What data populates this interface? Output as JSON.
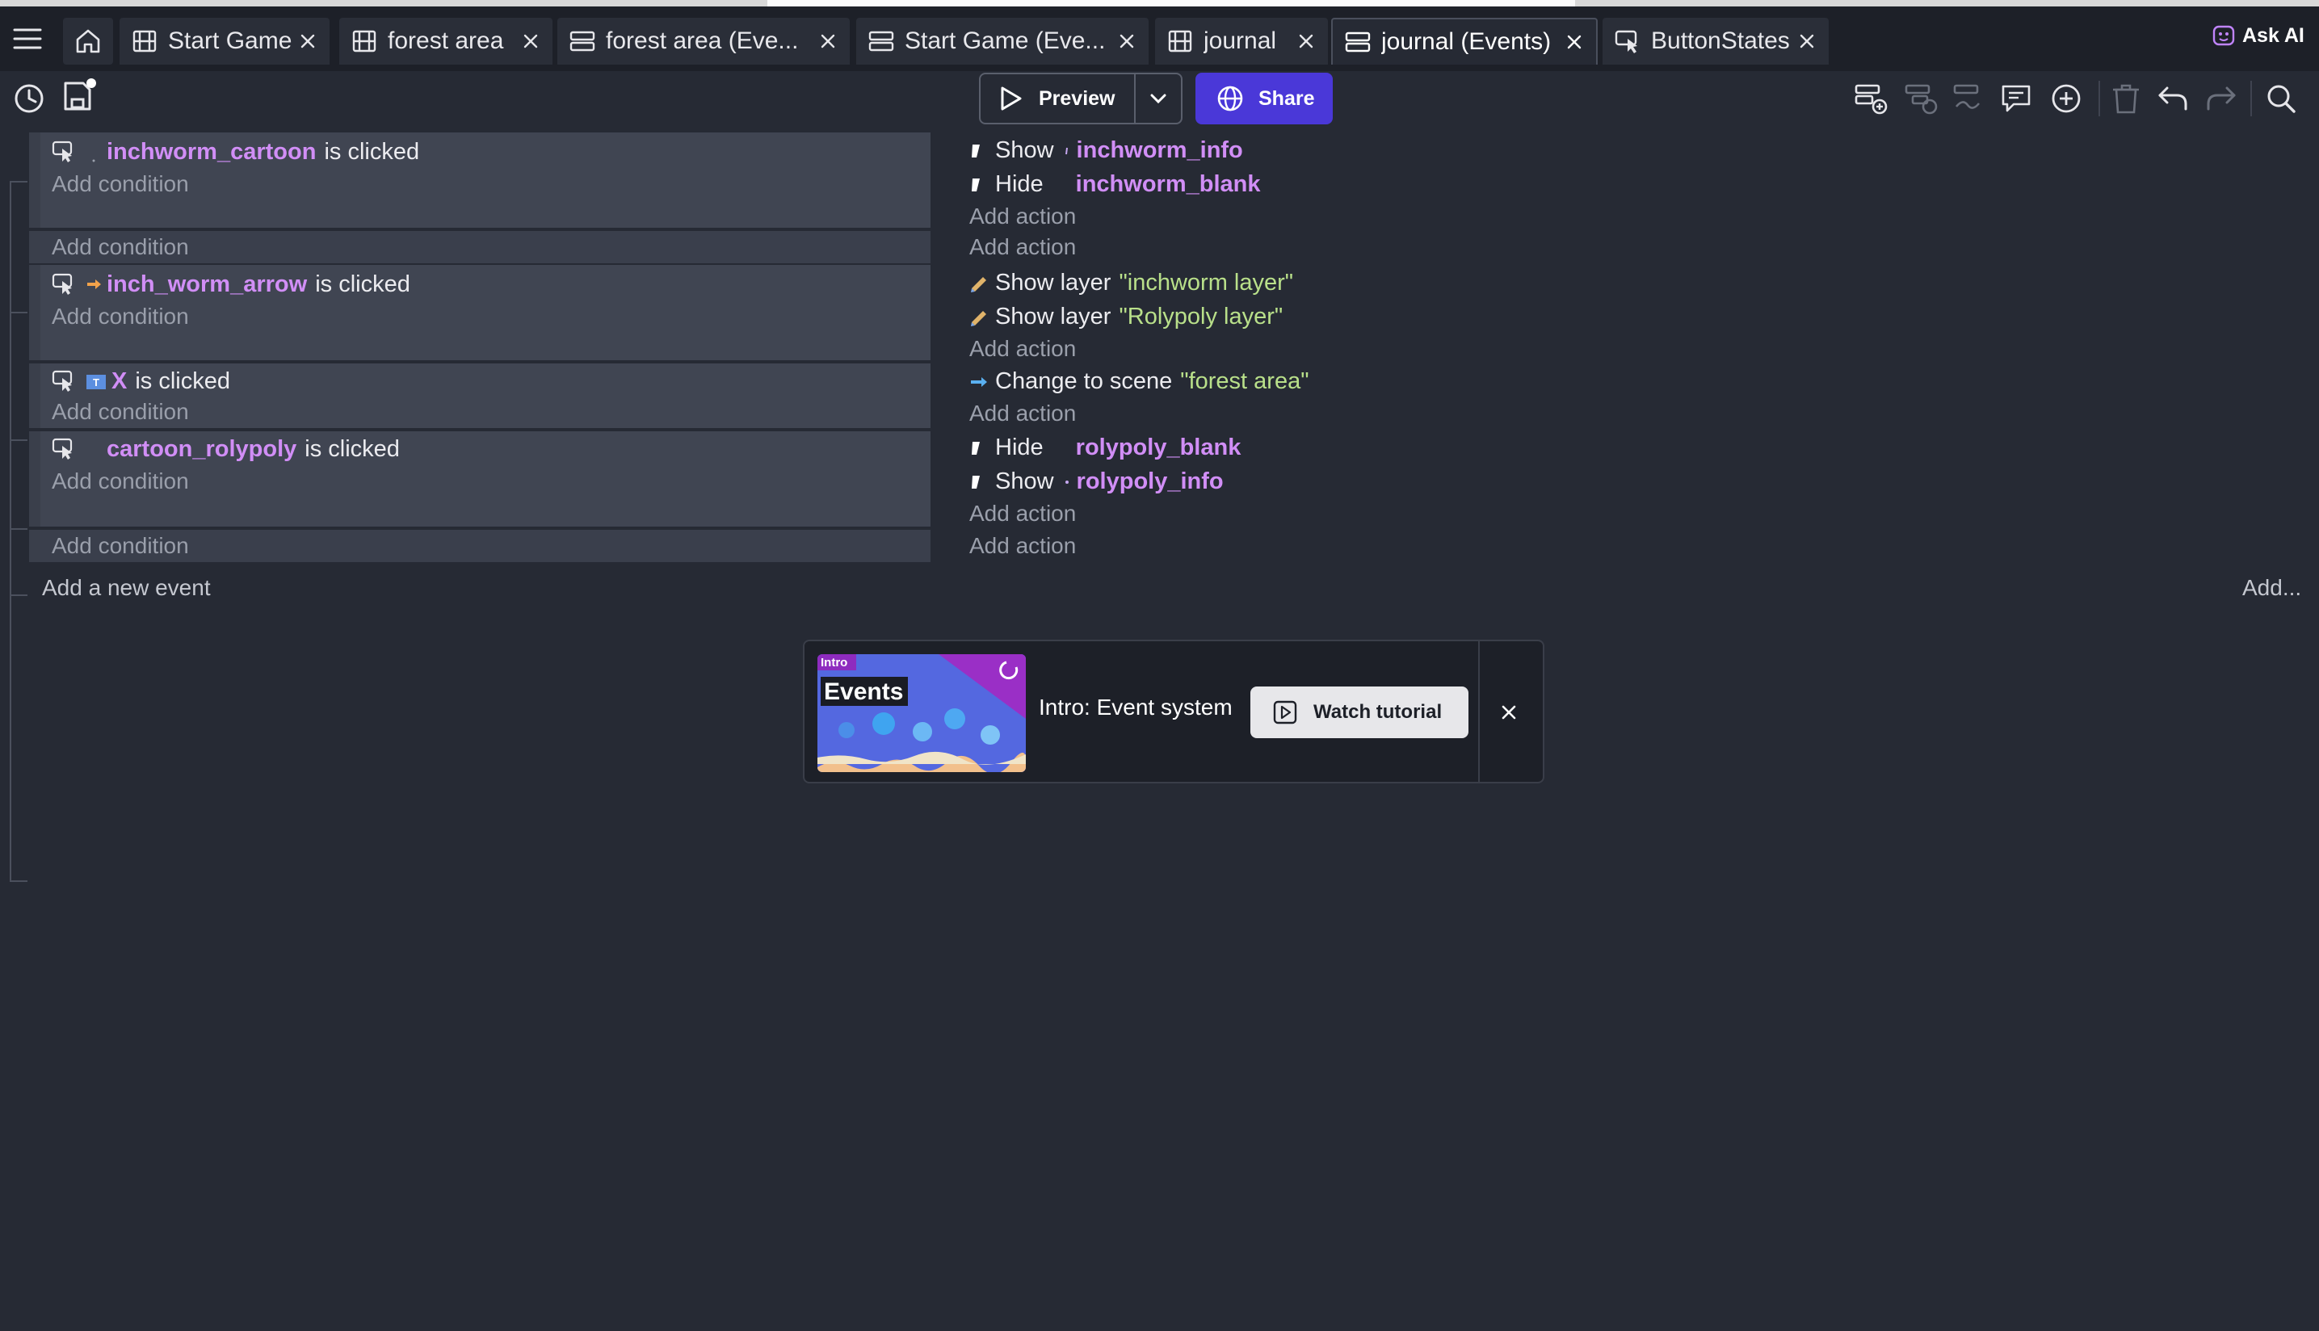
{
  "tabs": [
    {
      "label": "Start Game",
      "icon": "scene-icon",
      "active": false
    },
    {
      "label": "forest area",
      "icon": "scene-icon",
      "active": false
    },
    {
      "label": "forest area (Eve...",
      "icon": "events-icon",
      "active": false
    },
    {
      "label": "Start Game (Eve...",
      "icon": "events-icon",
      "active": false
    },
    {
      "label": "journal",
      "icon": "scene-icon",
      "active": false
    },
    {
      "label": "journal (Events)",
      "icon": "events-icon",
      "active": true
    },
    {
      "label": "ButtonStates",
      "icon": "button-states-icon",
      "active": false
    }
  ],
  "ask_ai": "Ask AI",
  "toolbar": {
    "preview_label": "Preview",
    "share_label": "Share"
  },
  "events": [
    {
      "condition": {
        "object": "inchworm_cartoon",
        "text": "is clicked"
      },
      "add_condition": "Add condition",
      "actions": [
        {
          "verb": "Show",
          "object": "inchworm_info"
        },
        {
          "verb": "Hide",
          "object": "inchworm_blank"
        }
      ],
      "add_action": "Add action"
    },
    {
      "sub_add_condition": "Add condition",
      "sub_add_action": "Add action"
    },
    {
      "condition": {
        "object": "inch_worm_arrow",
        "text": "is clicked"
      },
      "add_condition": "Add condition",
      "actions": [
        {
          "verb": "Show layer",
          "value": "\"inchworm layer\""
        },
        {
          "verb": "Show layer",
          "value": "\"Rolypoly layer\""
        }
      ],
      "add_action": "Add action"
    },
    {
      "condition": {
        "object": "X",
        "text": "is clicked"
      },
      "add_condition": "Add condition",
      "actions": [
        {
          "verb": "Change to scene",
          "value": "\"forest area\""
        }
      ],
      "add_action": "Add action"
    },
    {
      "condition": {
        "object": "cartoon_rolypoly",
        "text": "is clicked"
      },
      "add_condition": "Add condition",
      "actions": [
        {
          "verb": "Hide",
          "object": "rolypoly_blank"
        },
        {
          "verb": "Show",
          "object": "rolypoly_info"
        }
      ],
      "add_action": "Add action"
    },
    {
      "sub_add_condition": "Add condition",
      "sub_add_action": "Add action"
    }
  ],
  "add_new_event": "Add a new event",
  "add_more": "Add...",
  "tutorial": {
    "thumb_tag": "Intro",
    "thumb_title": "Events",
    "title": "Intro: Event system",
    "watch_label": "Watch tutorial"
  },
  "colors": {
    "accent": "#4a38d8",
    "object_name": "#d18ef6",
    "string_value": "#b9e08a",
    "background": "#262a34"
  }
}
